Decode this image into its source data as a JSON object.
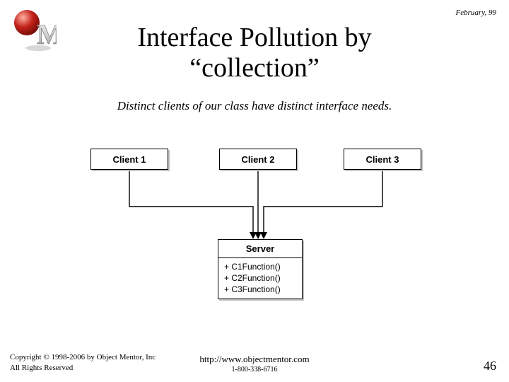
{
  "date": "February, 99",
  "title_line1": "Interface Pollution by",
  "title_line2": "“collection”",
  "subtitle": "Distinct clients of our class have distinct interface needs.",
  "clients": {
    "c1": "Client 1",
    "c2": "Client 2",
    "c3": "Client 3"
  },
  "server": {
    "name": "Server",
    "members": [
      "+ C1Function()",
      "+ C2Function()",
      "+ C3Function()"
    ]
  },
  "footer": {
    "copyright_line1": "Copyright © 1998-2006 by Object Mentor, Inc",
    "copyright_line2": "All Rights Reserved",
    "url": "http://www.objectmentor.com",
    "phone": "1-800-338-6716",
    "page": "46"
  },
  "logo": {
    "letter": "M"
  }
}
